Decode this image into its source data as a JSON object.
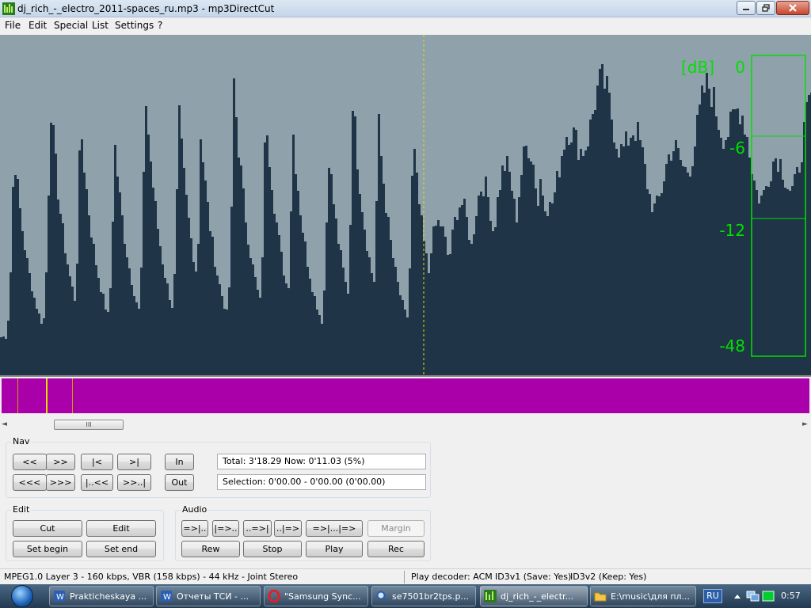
{
  "window": {
    "title": "dj_rich_-_electro_2011-spaces_ru.mp3 - mp3DirectCut",
    "icon": "mp3directcut-icon",
    "controls": [
      "minimize",
      "maximize",
      "close"
    ]
  },
  "menu": [
    "File",
    "Edit",
    "Special",
    "List",
    "Settings",
    "?"
  ],
  "waveform": {
    "db_unit": "[dB]",
    "db_labels": [
      "0",
      "-6",
      "-12",
      "-48"
    ],
    "colors": {
      "background": "#8fa1aa",
      "wave": "#1f3446",
      "meter": "#00ff00",
      "cursor": "#e8e000"
    }
  },
  "overview": {
    "color": "#aa00aa"
  },
  "scrollbar": {
    "thumb_label": "III"
  },
  "nav": {
    "label": "Nav",
    "row1": [
      "<<",
      ">>",
      "|<",
      ">|"
    ],
    "row2": [
      "<<<",
      ">>>",
      "|..<<",
      ">>..|"
    ],
    "in_label": "In",
    "out_label": "Out",
    "total_text": "Total: 3'18.29   Now: 0'11.03   (5%)",
    "selection_text": "Selection: 0'00.00 - 0'00.00 (0'00.00)"
  },
  "edit": {
    "label": "Edit",
    "cut": "Cut",
    "edit": "Edit",
    "set_begin": "Set begin",
    "set_end": "Set end"
  },
  "audio": {
    "label": "Audio",
    "row1": [
      "=>|..",
      "|=>..",
      "..=>|",
      "..|=>",
      "=>|...|=>",
      "Margin"
    ],
    "rew": "Rew",
    "stop": "Stop",
    "play": "Play",
    "rec": "Rec"
  },
  "status": {
    "format": "MPEG1.0 Layer 3 - 160 kbps, VBR (158 kbps) - 44 kHz - Joint Stereo",
    "decoder": "Play decoder: ACM",
    "id3v1": "ID3v1 (Save: Yes)",
    "id3v2": "ID3v2 (Keep: Yes)"
  },
  "taskbar": {
    "items": [
      {
        "label": "Prakticheskaya ...",
        "icon": "word-icon"
      },
      {
        "label": "Отчеты ТСИ - ...",
        "icon": "word-icon"
      },
      {
        "label": "\"Samsung Sync...",
        "icon": "opera-icon"
      },
      {
        "label": "se7501br2tps.p...",
        "icon": "search-icon"
      },
      {
        "label": "dj_rich_-_electr...",
        "icon": "mp3directcut-icon"
      },
      {
        "label": "E:\\music\\для пл...",
        "icon": "folder-icon"
      }
    ],
    "language": "RU",
    "clock": "0:57"
  }
}
